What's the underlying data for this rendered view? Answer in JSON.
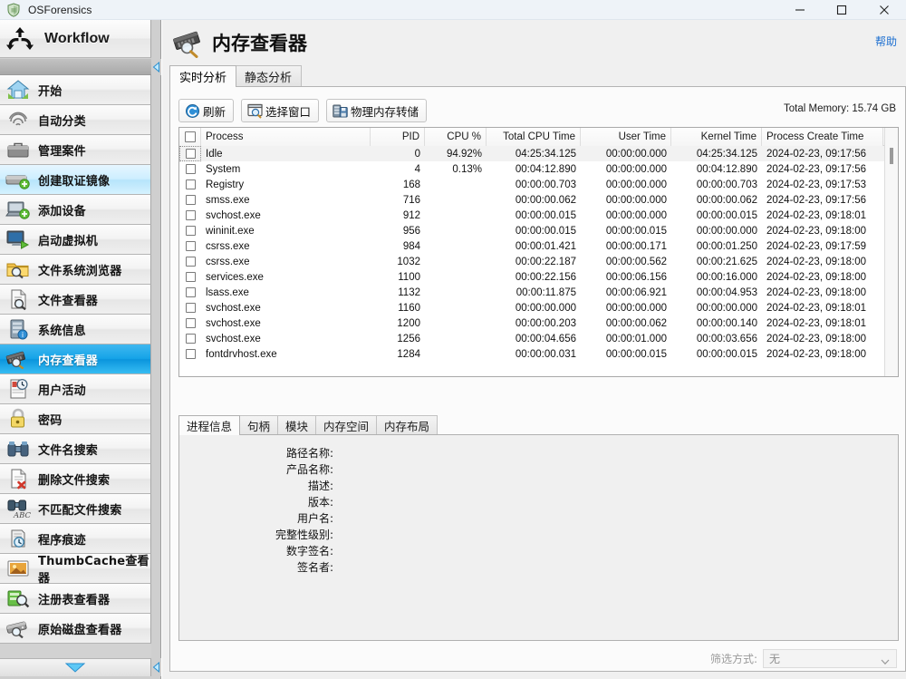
{
  "window": {
    "title": "OSForensics",
    "app_icon": "shield-icon",
    "controls": {
      "minimize": "—",
      "maximize": "□",
      "close": "✕"
    }
  },
  "sidebar": {
    "header": {
      "label": "Workflow",
      "icon": "workflow-arrows-icon"
    },
    "scroll_up_icon": "scroll-up",
    "scroll_down_icon": "chevron-down-icon",
    "collapse_icon": "chevron-left-icon",
    "items": [
      {
        "label": "开始",
        "icon": "home-icon",
        "state": "normal"
      },
      {
        "label": "自动分类",
        "icon": "fingerprint-icon",
        "state": "normal"
      },
      {
        "label": "管理案件",
        "icon": "briefcase-icon",
        "state": "normal"
      },
      {
        "label": "创建取证镜像",
        "icon": "drive-add-icon",
        "state": "hover"
      },
      {
        "label": "添加设备",
        "icon": "device-add-icon",
        "state": "normal"
      },
      {
        "label": "启动虚拟机",
        "icon": "monitor-play-icon",
        "state": "normal"
      },
      {
        "label": "文件系统浏览器",
        "icon": "folder-search-icon",
        "state": "normal"
      },
      {
        "label": "文件查看器",
        "icon": "file-search-icon",
        "state": "normal"
      },
      {
        "label": "系统信息",
        "icon": "server-info-icon",
        "state": "normal"
      },
      {
        "label": "内存查看器",
        "icon": "memory-search-icon",
        "state": "selected"
      },
      {
        "label": "用户活动",
        "icon": "user-activity-icon",
        "state": "normal"
      },
      {
        "label": "密码",
        "icon": "padlock-icon",
        "state": "normal"
      },
      {
        "label": "文件名搜索",
        "icon": "binoculars-icon",
        "state": "normal"
      },
      {
        "label": "删除文件搜索",
        "icon": "file-delete-icon",
        "state": "normal"
      },
      {
        "label": "不匹配文件搜索",
        "icon": "binoculars-abc-icon",
        "state": "normal"
      },
      {
        "label": "程序痕迹",
        "icon": "recent-activity-icon",
        "state": "normal"
      },
      {
        "label": "ThumbCache查看器",
        "icon": "thumbnail-icon",
        "state": "normal"
      },
      {
        "label": "注册表查看器",
        "icon": "registry-icon",
        "state": "normal"
      },
      {
        "label": "原始磁盘查看器",
        "icon": "raw-disk-icon",
        "state": "normal"
      }
    ]
  },
  "page": {
    "title": "内存查看器",
    "title_icon": "memory-search-icon",
    "help_label": "帮助",
    "tabs": [
      {
        "label": "实时分析",
        "active": true
      },
      {
        "label": "静态分析",
        "active": false
      }
    ]
  },
  "toolbar": {
    "buttons": [
      {
        "label": "刷新",
        "icon": "refresh-icon"
      },
      {
        "label": "选择窗口",
        "icon": "select-window-icon"
      },
      {
        "label": "物理内存转储",
        "icon": "memory-dump-icon"
      }
    ],
    "total_memory": "Total Memory: 15.74 GB"
  },
  "process_table": {
    "columns": [
      {
        "label": "",
        "key": "check",
        "align": "center"
      },
      {
        "label": "Process",
        "key": "process",
        "align": "left"
      },
      {
        "label": "PID",
        "key": "pid",
        "align": "right"
      },
      {
        "label": "CPU %",
        "key": "cpu",
        "align": "right"
      },
      {
        "label": "Total CPU Time",
        "key": "total_cpu",
        "align": "right"
      },
      {
        "label": "User Time",
        "key": "user_time",
        "align": "right"
      },
      {
        "label": "Kernel Time",
        "key": "kernel_time",
        "align": "right"
      },
      {
        "label": "Process Create Time",
        "key": "create_time",
        "align": "left"
      }
    ],
    "rows": [
      {
        "process": "Idle",
        "pid": "0",
        "cpu": "94.92%",
        "total_cpu": "04:25:34.125",
        "user_time": "00:00:00.000",
        "kernel_time": "04:25:34.125",
        "create_time": "2024-02-23, 09:17:56",
        "selected": true
      },
      {
        "process": "System",
        "pid": "4",
        "cpu": "0.13%",
        "total_cpu": "00:04:12.890",
        "user_time": "00:00:00.000",
        "kernel_time": "00:04:12.890",
        "create_time": "2024-02-23, 09:17:56",
        "selected": false
      },
      {
        "process": "Registry",
        "pid": "168",
        "cpu": "",
        "total_cpu": "00:00:00.703",
        "user_time": "00:00:00.000",
        "kernel_time": "00:00:00.703",
        "create_time": "2024-02-23, 09:17:53",
        "selected": false
      },
      {
        "process": "smss.exe",
        "pid": "716",
        "cpu": "",
        "total_cpu": "00:00:00.062",
        "user_time": "00:00:00.000",
        "kernel_time": "00:00:00.062",
        "create_time": "2024-02-23, 09:17:56",
        "selected": false
      },
      {
        "process": "svchost.exe",
        "pid": "912",
        "cpu": "",
        "total_cpu": "00:00:00.015",
        "user_time": "00:00:00.000",
        "kernel_time": "00:00:00.015",
        "create_time": "2024-02-23, 09:18:01",
        "selected": false
      },
      {
        "process": "wininit.exe",
        "pid": "956",
        "cpu": "",
        "total_cpu": "00:00:00.015",
        "user_time": "00:00:00.015",
        "kernel_time": "00:00:00.000",
        "create_time": "2024-02-23, 09:18:00",
        "selected": false
      },
      {
        "process": "csrss.exe",
        "pid": "984",
        "cpu": "",
        "total_cpu": "00:00:01.421",
        "user_time": "00:00:00.171",
        "kernel_time": "00:00:01.250",
        "create_time": "2024-02-23, 09:17:59",
        "selected": false
      },
      {
        "process": "csrss.exe",
        "pid": "1032",
        "cpu": "",
        "total_cpu": "00:00:22.187",
        "user_time": "00:00:00.562",
        "kernel_time": "00:00:21.625",
        "create_time": "2024-02-23, 09:18:00",
        "selected": false
      },
      {
        "process": "services.exe",
        "pid": "1100",
        "cpu": "",
        "total_cpu": "00:00:22.156",
        "user_time": "00:00:06.156",
        "kernel_time": "00:00:16.000",
        "create_time": "2024-02-23, 09:18:00",
        "selected": false
      },
      {
        "process": "lsass.exe",
        "pid": "1132",
        "cpu": "",
        "total_cpu": "00:00:11.875",
        "user_time": "00:00:06.921",
        "kernel_time": "00:00:04.953",
        "create_time": "2024-02-23, 09:18:00",
        "selected": false
      },
      {
        "process": "svchost.exe",
        "pid": "1160",
        "cpu": "",
        "total_cpu": "00:00:00.000",
        "user_time": "00:00:00.000",
        "kernel_time": "00:00:00.000",
        "create_time": "2024-02-23, 09:18:01",
        "selected": false
      },
      {
        "process": "svchost.exe",
        "pid": "1200",
        "cpu": "",
        "total_cpu": "00:00:00.203",
        "user_time": "00:00:00.062",
        "kernel_time": "00:00:00.140",
        "create_time": "2024-02-23, 09:18:01",
        "selected": false
      },
      {
        "process": "svchost.exe",
        "pid": "1256",
        "cpu": "",
        "total_cpu": "00:00:04.656",
        "user_time": "00:00:01.000",
        "kernel_time": "00:00:03.656",
        "create_time": "2024-02-23, 09:18:00",
        "selected": false
      },
      {
        "process": "fontdrvhost.exe",
        "pid": "1284",
        "cpu": "",
        "total_cpu": "00:00:00.031",
        "user_time": "00:00:00.015",
        "kernel_time": "00:00:00.015",
        "create_time": "2024-02-23, 09:18:00",
        "selected": false
      }
    ]
  },
  "detail": {
    "tabs": [
      {
        "label": "进程信息",
        "active": true
      },
      {
        "label": "句柄",
        "active": false
      },
      {
        "label": "模块",
        "active": false
      },
      {
        "label": "内存空间",
        "active": false
      },
      {
        "label": "内存布局",
        "active": false
      }
    ],
    "fields": [
      {
        "label": "路径名称:",
        "value": ""
      },
      {
        "label": "产品名称:",
        "value": ""
      },
      {
        "label": "描述:",
        "value": ""
      },
      {
        "label": "版本:",
        "value": ""
      },
      {
        "label": "用户名:",
        "value": ""
      },
      {
        "label": "完整性级别:",
        "value": ""
      },
      {
        "label": "数字签名:",
        "value": ""
      },
      {
        "label": "签名者:",
        "value": ""
      }
    ]
  },
  "filter": {
    "label": "筛选方式:",
    "value": "无",
    "chevron_icon": "chevron-down-icon"
  },
  "colors": {
    "accent_selected": "#16a4e8",
    "accent_hover": "#b6e4fb",
    "link": "#1d6fd0",
    "titlebar_bg": "#eef3f8"
  }
}
